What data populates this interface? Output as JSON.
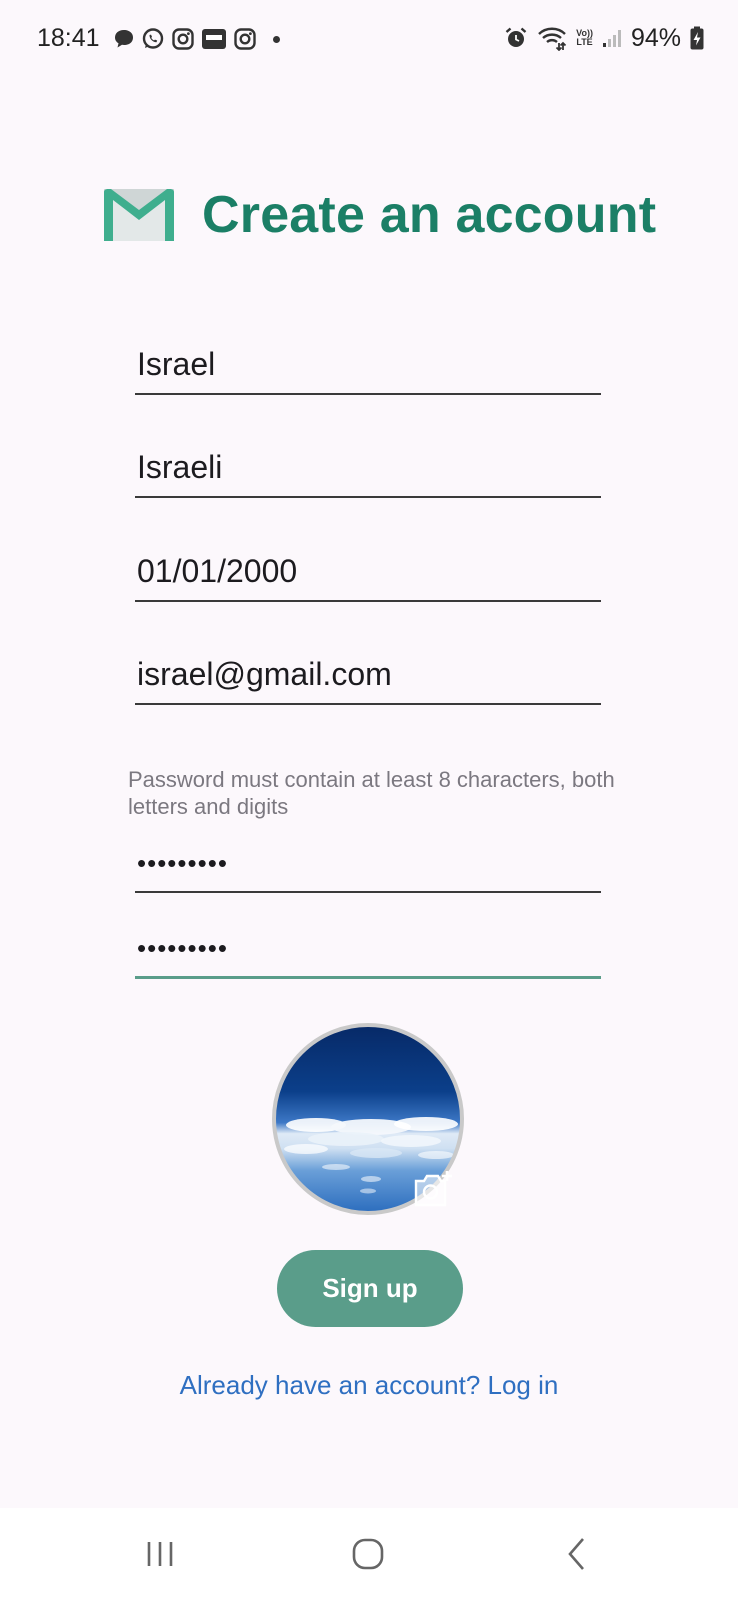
{
  "status_bar": {
    "time": "18:41",
    "battery": "94%",
    "left_icons": [
      "chat-bubble-icon",
      "whatsapp-icon",
      "instagram-icon",
      "news-app-icon",
      "instagram-icon",
      "notification-dot"
    ],
    "right_icons": [
      "alarm-icon",
      "wifi-icon",
      "volte-icon",
      "signal-icon",
      "battery-charging-icon"
    ],
    "volte_top": "Vo))",
    "volte_bottom": "LTE"
  },
  "header": {
    "icon": "envelope-icon",
    "title": "Create an account",
    "title_color": "#1b7f66"
  },
  "form": {
    "first_name": "Israel",
    "last_name": "Israeli",
    "birth_date": "01/01/2000",
    "email": "israel@gmail.com",
    "password_hint": "Password must contain at least 8 characters, both letters and digits",
    "password": "•••••••••",
    "confirm_password": "•••••••••"
  },
  "avatar": {
    "description_icon": "profile-photo",
    "camera_icon": "add-photo-icon"
  },
  "actions": {
    "signup_label": "Sign up",
    "signup_color": "#5a9d8a",
    "login_link": "Already have an account? Log in",
    "link_color": "#2f6fc1"
  },
  "nav_bar": {
    "buttons": [
      "recents-icon",
      "home-icon",
      "back-icon"
    ]
  }
}
